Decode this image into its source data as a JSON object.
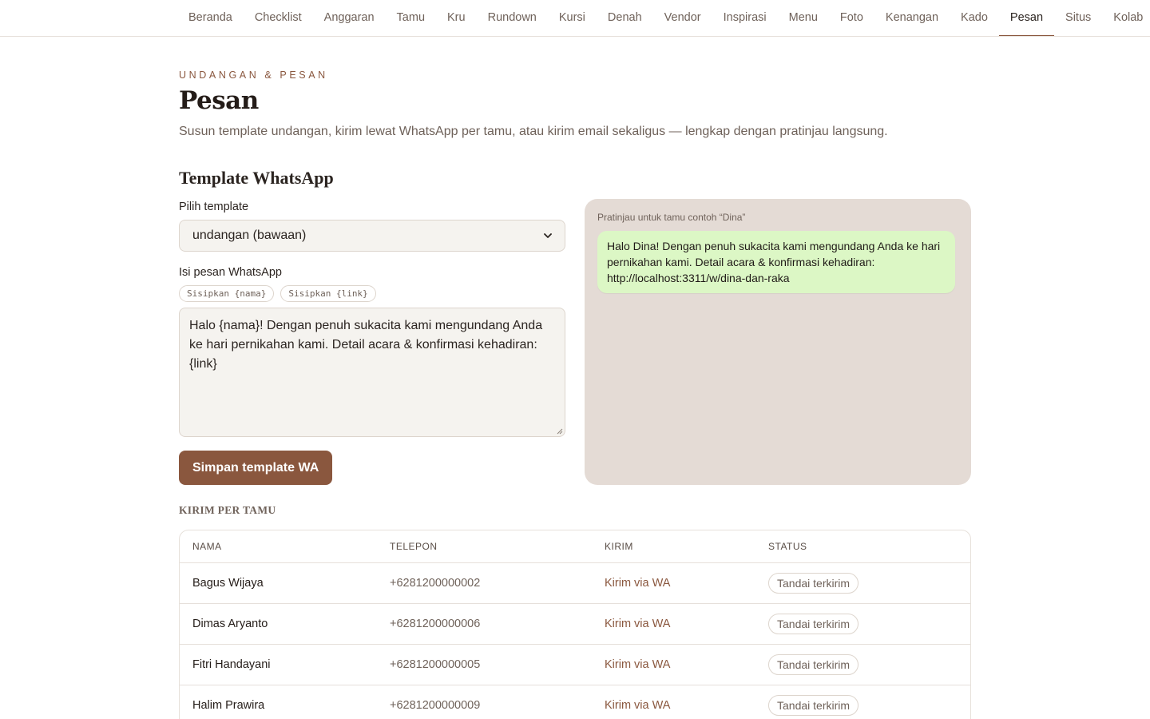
{
  "nav": {
    "tabs": [
      "Beranda",
      "Checklist",
      "Anggaran",
      "Tamu",
      "Kru",
      "Rundown",
      "Kursi",
      "Denah",
      "Vendor",
      "Inspirasi",
      "Menu",
      "Foto",
      "Kenangan",
      "Kado",
      "Pesan",
      "Situs",
      "Kolab"
    ],
    "active": "Pesan"
  },
  "header": {
    "eyebrow": "UNDANGAN & PESAN",
    "title": "Pesan",
    "subtitle": "Susun template undangan, kirim lewat WhatsApp per tamu, atau kirim email sekaligus — lengkap dengan pratinjau langsung."
  },
  "whatsapp": {
    "section_title": "Template WhatsApp",
    "select_label": "Pilih template",
    "select_value": "undangan (bawaan)",
    "message_label": "Isi pesan WhatsApp",
    "chips": [
      "Sisipkan {nama}",
      "Sisipkan {link}"
    ],
    "message_value": "Halo {nama}! Dengan penuh sukacita kami mengundang Anda ke hari pernikahan kami. Detail acara & konfirmasi kehadiran: {link}",
    "save_label": "Simpan template WA",
    "preview_caption": "Pratinjau untuk tamu contoh “Dina”",
    "preview_text": "Halo Dina! Dengan penuh sukacita kami mengundang Anda ke hari pernikahan kami. Detail acara & konfirmasi kehadiran: http://localhost:3311/w/dina-dan-raka"
  },
  "kirim": {
    "title": "KIRIM PER TAMU",
    "headers": {
      "nama": "NAMA",
      "telepon": "TELEPON",
      "kirim": "KIRIM",
      "status": "STATUS"
    },
    "rows": [
      {
        "nama": "Bagus Wijaya",
        "telepon": "+6281200000002",
        "kirim": "Kirim via WA",
        "status": "Tandai terkirim"
      },
      {
        "nama": "Dimas Aryanto",
        "telepon": "+6281200000006",
        "kirim": "Kirim via WA",
        "status": "Tandai terkirim"
      },
      {
        "nama": "Fitri Handayani",
        "telepon": "+6281200000005",
        "kirim": "Kirim via WA",
        "status": "Tandai terkirim"
      },
      {
        "nama": "Halim Prawira",
        "telepon": "+6281200000009",
        "kirim": "Kirim via WA",
        "status": "Tandai terkirim"
      }
    ]
  },
  "colors": {
    "accent": "#8a573e",
    "preview_bg": "#e4dbd5",
    "bubble_bg": "#dcf7c5"
  },
  "icons": {
    "select": "chevron-down-icon",
    "textarea": "resize-grip-icon"
  }
}
